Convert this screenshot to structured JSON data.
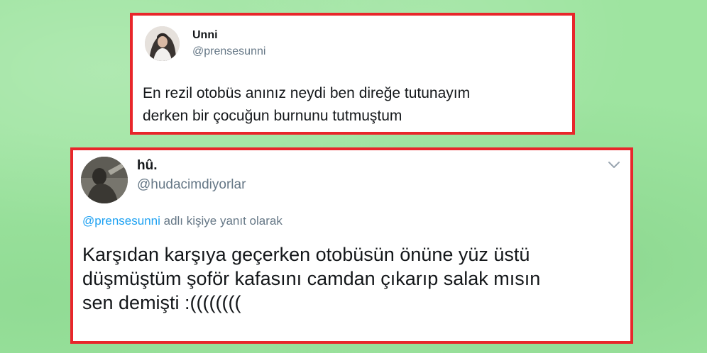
{
  "colors": {
    "background": "#9ee4a0",
    "card_border": "#e8262b",
    "mention": "#1da1f2",
    "secondary_text": "#657786"
  },
  "tweet1": {
    "name": "Unni",
    "handle": "@prensesunni",
    "body_lines": [
      "En rezil otobüs anınız neydi ben direğe tutunayım",
      "derken bir çocuğun burnunu tutmuştum"
    ]
  },
  "tweet2": {
    "name": "hû.",
    "handle": "@hudacimdiyorlar",
    "menu_icon": "chevron-down-icon",
    "reply_to_mention": "@prensesunni",
    "reply_to_suffix": " adlı kişiye yanıt olarak",
    "body_lines": [
      "Karşıdan karşıya geçerken otobüsün önüne yüz üstü",
      "düşmüştüm şoför kafasını camdan çıkarıp salak mısın",
      "sen demişti :(((((((("
    ]
  }
}
